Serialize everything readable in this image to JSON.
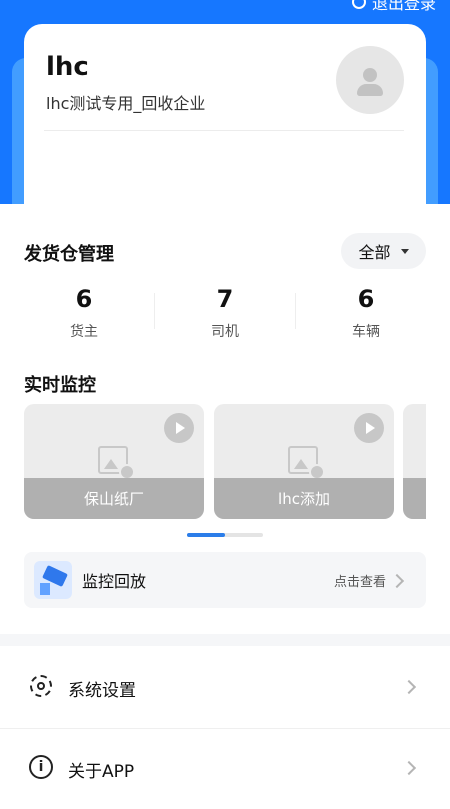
{
  "header": {
    "logout_label": "退出登录"
  },
  "profile": {
    "name": "lhc",
    "company": "lhc测试专用_回收企业"
  },
  "warehouse": {
    "title": "发货仓管理",
    "filter_label": "全部",
    "stats": [
      {
        "value": "6",
        "label": "货主"
      },
      {
        "value": "7",
        "label": "司机"
      },
      {
        "value": "6",
        "label": "车辆"
      }
    ]
  },
  "monitor": {
    "title": "实时监控",
    "cards": [
      {
        "label": "保山纸厂"
      },
      {
        "label": "lhc添加"
      }
    ]
  },
  "playback": {
    "label": "监控回放",
    "hint": "点击查看"
  },
  "menu": [
    {
      "label": "系统设置",
      "icon": "gear-icon"
    },
    {
      "label": "关于APP",
      "icon": "info-icon"
    }
  ],
  "colors": {
    "primary": "#1677ff",
    "accent": "#2b7de9"
  }
}
